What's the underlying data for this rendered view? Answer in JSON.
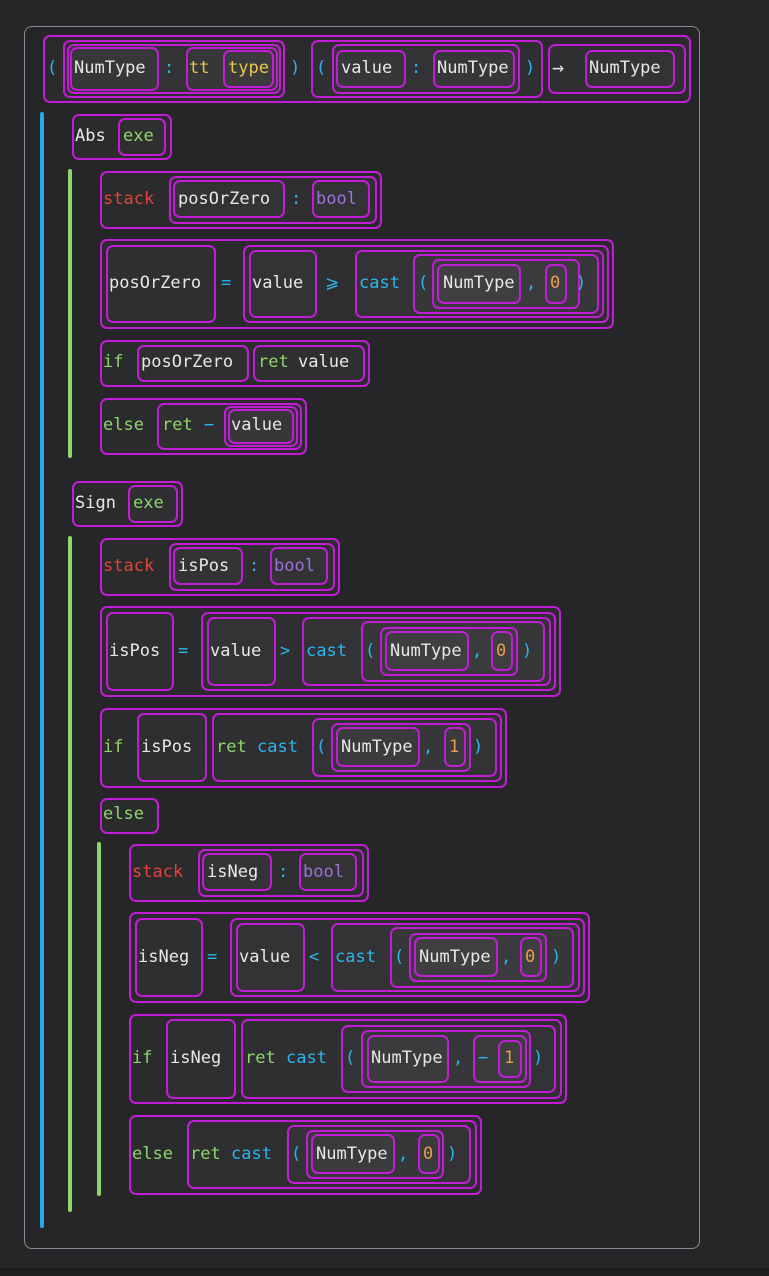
{
  "colors": {
    "background": "#262628",
    "box_border": "#c21cd6",
    "identifier": "#e8e8e8",
    "keyword_green": "#8ed66b",
    "keyword_red": "#e0453a",
    "type_purple": "#9b72d8",
    "type_yellow": "#e6c84a",
    "punct_blue": "#29b6f0",
    "number_orange": "#e89f4a",
    "block_bar_blue": "#29a8e8",
    "block_bar_green": "#8ed66b"
  },
  "signature": {
    "open_paren_1": "(",
    "param_type_name": "NumType",
    "colon_1": ":",
    "tt": "tt",
    "type_kw": "type",
    "close_paren_1": ")",
    "open_paren_2": "(",
    "param_name": "value",
    "colon_2": ":",
    "param_type": "NumType",
    "close_paren_2": ")",
    "arrow": "→",
    "return_type": "NumType"
  },
  "abs_fn": {
    "name": "Abs",
    "kind": "exe",
    "stack_kw": "stack",
    "var": "posOrZero",
    "colon": ":",
    "var_type": "bool",
    "assign_target": "posOrZero",
    "eq": "=",
    "lhs": "value",
    "op": "⩾",
    "cast": "cast",
    "lp": "(",
    "cast_type": "NumType",
    "comma": ",",
    "zero": "0",
    "rp": ")",
    "if_kw": "if",
    "cond": "posOrZero",
    "ret_kw": "ret",
    "ret_val": "value",
    "else_kw": "else",
    "else_ret": "ret",
    "neg": "−",
    "else_val": "value"
  },
  "sign_fn": {
    "name": "Sign",
    "kind": "exe",
    "stack_kw": "stack",
    "var": "isPos",
    "colon": ":",
    "var_type": "bool",
    "assign_target": "isPos",
    "eq": "=",
    "lhs": "value",
    "op": ">",
    "cast": "cast",
    "lp": "(",
    "cast_type": "NumType",
    "comma": ",",
    "zero": "0",
    "rp": ")",
    "if_kw": "if",
    "cond": "isPos",
    "ret_kw": "ret",
    "ret_cast": "cast",
    "ret_lp": "(",
    "ret_type": "NumType",
    "ret_comma": ",",
    "one": "1",
    "ret_rp": ")",
    "else_kw": "else",
    "inner": {
      "stack_kw": "stack",
      "var": "isNeg",
      "colon": ":",
      "var_type": "bool",
      "assign_target": "isNeg",
      "eq": "=",
      "lhs": "value",
      "op": "<",
      "cast": "cast",
      "lp": "(",
      "cast_type": "NumType",
      "comma": ",",
      "zero": "0",
      "rp": ")",
      "if_kw": "if",
      "cond": "isNeg",
      "ret_kw": "ret",
      "ret_cast": "cast",
      "ret_lp": "(",
      "ret_type": "NumType",
      "ret_comma": ",",
      "neg": "−",
      "one": "1",
      "ret_rp": ")",
      "else_kw": "else",
      "else_ret": "ret",
      "else_cast": "cast",
      "else_lp": "(",
      "else_type": "NumType",
      "else_comma": ",",
      "else_zero": "0",
      "else_rp": ")"
    }
  }
}
